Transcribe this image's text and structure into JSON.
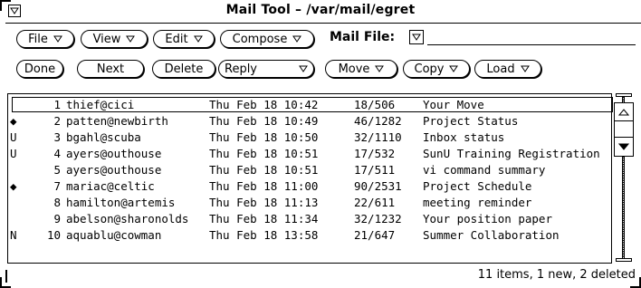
{
  "window": {
    "title": "Mail Tool  – /var/mail/egret"
  },
  "toolbar1": {
    "file": "File",
    "view": "View",
    "edit": "Edit",
    "compose": "Compose",
    "mail_file_label": "Mail File:",
    "mail_file_value": ""
  },
  "toolbar2": {
    "done": "Done",
    "next": "Next",
    "delete": "Delete",
    "reply": "Reply",
    "move": "Move",
    "copy": "Copy",
    "load": "Load"
  },
  "messages": [
    {
      "flag": "",
      "num": "1",
      "from": "thief@cici",
      "date": "Thu Feb 18 10:42",
      "size": "18/506",
      "subject": "Your Move"
    },
    {
      "flag": "◆",
      "num": "2",
      "from": "patten@newbirth",
      "date": "Thu Feb 18 10:49",
      "size": "46/1282",
      "subject": "Project Status"
    },
    {
      "flag": "U",
      "num": "3",
      "from": "bgahl@scuba",
      "date": "Thu Feb 18 10:50",
      "size": "32/1110",
      "subject": "Inbox status"
    },
    {
      "flag": "U",
      "num": "4",
      "from": "ayers@outhouse",
      "date": "Thu Feb 18 10:51",
      "size": "17/532",
      "subject": "SunU Training Registration"
    },
    {
      "flag": "",
      "num": "5",
      "from": "ayers@outhouse",
      "date": "Thu Feb 18 10:51",
      "size": "17/511",
      "subject": "vi command summary"
    },
    {
      "flag": "◆",
      "num": "7",
      "from": "mariac@celtic",
      "date": "Thu Feb 18 11:00",
      "size": "90/2531",
      "subject": "Project Schedule"
    },
    {
      "flag": "",
      "num": "8",
      "from": "hamilton@artemis",
      "date": "Thu Feb 18 11:13",
      "size": "22/611",
      "subject": "meeting reminder"
    },
    {
      "flag": "",
      "num": "9",
      "from": "abelson@sharonolds",
      "date": "Thu Feb 18 11:34",
      "size": "32/1232",
      "subject": "Your position paper"
    },
    {
      "flag": "N",
      "num": "10",
      "from": "aquablu@cowman",
      "date": "Thu Feb 18 13:58",
      "size": "21/647",
      "subject": "Summer Collaboration"
    }
  ],
  "selected_row": 0,
  "status": "11 items, 1 new, 2 deleted"
}
